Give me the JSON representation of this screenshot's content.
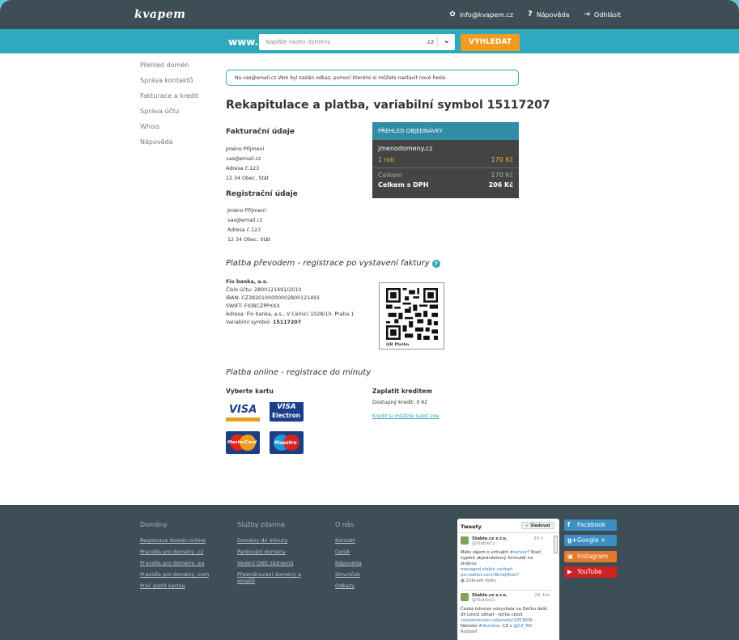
{
  "header": {
    "logo": "kvapem",
    "email": "info@kvapem.cz",
    "help": "Nápověda",
    "logout": "Odhlásit"
  },
  "search": {
    "prefix": "www.",
    "placeholder": "Napište název domény",
    "tld": ".cz",
    "button": "VYHLEDAT"
  },
  "sidebar": {
    "items": [
      {
        "label": "Přehled domén"
      },
      {
        "label": "Správa kontaktů"
      },
      {
        "label": "Fakturace a kredit"
      },
      {
        "label": "Správa účtu"
      },
      {
        "label": "Whois"
      },
      {
        "label": "Nápověda"
      }
    ]
  },
  "alert": {
    "prefix": "Na",
    "email": "vas@email.cz",
    "text": "Vám byl zaslán odkaz, pomocí kterého si můžete nastavit nové heslo."
  },
  "page_title": "Rekapitulace a platba, variabilní symbol 15117207",
  "billing": {
    "title": "Fakturační údaje",
    "lines": [
      "Jméno Příjmení",
      "vas@email.cz",
      "Adresa č.123",
      "12 34 Obec, Stát"
    ]
  },
  "registration": {
    "title": "Registrační údaje",
    "lines": [
      "Jméno Příjmení",
      "vas@email.cz",
      "Adresa č.123",
      "12 34 Obec, Stát"
    ]
  },
  "order": {
    "title": "PŘEHLED OBJEDNÁVKY",
    "domain": "jmenodomeny.cz",
    "period": "1 rok",
    "period_price": "170 Kč",
    "total_label": "Celkem",
    "total": "170 Kč",
    "total_vat_label": "Celkem s DPH",
    "total_vat": "206 Kč"
  },
  "transfer": {
    "title": "Platba převodem - registrace po vystavení faktury",
    "bank": "Fio banka, a.s.",
    "account": "Číslo účtu: 2800121491/2010",
    "iban": "IBAN: CZ3820100000002800121491",
    "swift": "SWIFT: FIOBCZPPXXX",
    "address": "Adresa: Fio banka, a.s., V Celnici 1028/10, Praha 1",
    "vs_label": "Variabilní symbol:",
    "vs": "15117207",
    "qr_label": "QR Platba"
  },
  "online": {
    "title": "Platba online - registrace do minuty",
    "card_title": "Vyberte kartu",
    "cards": {
      "visa": "VISA",
      "visa_electron_top": "VISA",
      "visa_electron_bottom": "Electron",
      "mastercard": "MasterCard",
      "maestro": "Maestro"
    },
    "credit_title": "Zaplatit kreditem",
    "credit_available": "Dostupný kredit: 0 Kč",
    "credit_link": "Kredit si můžete nabít zde"
  },
  "footer": {
    "columns": [
      {
        "title": "Domény",
        "links": [
          "Registrace domén online",
          "Pravidla pro domény .cz",
          "Pravidla pro domény .eu",
          "Pravidla pro domény .com",
          "Proč platit kartou"
        ]
      },
      {
        "title": "Služby zdarma",
        "links": [
          "Domény do minuty",
          "Parkování domény",
          "Vedení DNS záznamů",
          "Přesměrování domény a emailů"
        ]
      },
      {
        "title": "O nás",
        "links": [
          "Kontakt",
          "Ceník",
          "Nápověda",
          "Slovníček",
          "Odkazy"
        ]
      }
    ],
    "tweets": {
      "title": "Tweety",
      "follow": "Sledovat",
      "items": [
        {
          "name": "Stable.cz s.r.o.",
          "handle": "@StableCz",
          "time": "20 h",
          "text1": "Máte zájem o virtuální ",
          "tag1": "#server",
          "text2": "? Stačí vyplnit objednávkový formulář na stránce ",
          "link1": "managed.stable.cz/start",
          "link2": "pic.twitter.com/WcrqQKdx7",
          "action": "Zobrazit fotku"
        },
        {
          "name": "Stable.cz s.r.o.",
          "handle": "@StableCz",
          "time": "24. bře.",
          "text1": "Česká televize odvysílala na Déčku další díl Lovců záhad - tečka cézet ",
          "link1": "ceskatelevize.cz/porady/1053606...",
          "text2": " Národní ",
          "tag1": "#doména",
          "text3": " .CZ s ",
          "tag2": "@CZ_NIC",
          "action": "Rozbalit"
        }
      ]
    },
    "social": [
      {
        "label": "Facebook",
        "color": "#3b8fc2",
        "icon": "f"
      },
      {
        "label": "Google +",
        "color": "#3b8fc2",
        "icon": "g+"
      },
      {
        "label": "Instagram",
        "color": "#e5782a",
        "icon": "▣"
      },
      {
        "label": "YouTube",
        "color": "#cc2222",
        "icon": "▶"
      }
    ]
  }
}
